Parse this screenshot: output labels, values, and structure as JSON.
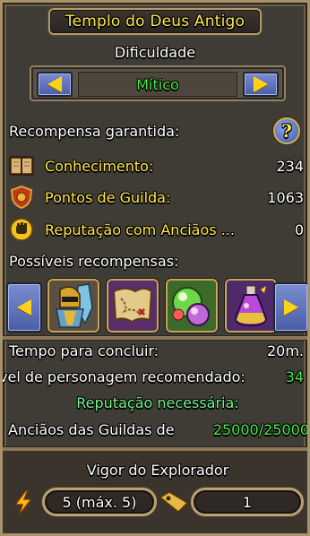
{
  "title": "Templo do Deus Antigo",
  "difficulty": {
    "label": "Dificuldade",
    "value": "Mítico"
  },
  "guaranteed": {
    "heading": "Recompensa garantida:",
    "items": [
      {
        "icon": "book-icon",
        "label": "Conhecimento:",
        "value": "234"
      },
      {
        "icon": "guild-shield-icon",
        "label": "Pontos de Guilda:",
        "value": "1063"
      },
      {
        "icon": "elders-fist-icon",
        "label": "Reputação com Anciãos ...",
        "value": "0"
      }
    ]
  },
  "possible": {
    "heading": "Possíveis recompensas:",
    "items": [
      {
        "icon": "knight-armor-icon"
      },
      {
        "icon": "treasure-map-icon"
      },
      {
        "icon": "magic-orbs-icon"
      },
      {
        "icon": "potion-flask-icon"
      }
    ]
  },
  "info": {
    "time_label": "Tempo para concluir:",
    "time_value": "20m.",
    "level_label": "vel de personagem recomendado:",
    "level_value": "34",
    "rep_required": "Reputação necessária:",
    "rep_label": "Anciãos das Guildas de",
    "rep_value": "25000/25000"
  },
  "vigor": {
    "title": "Vigor do Explorador",
    "energy": "5 (máx. 5)",
    "tickets": "1"
  },
  "colors": {
    "label_gold": "#ffe94a",
    "value_green": "#48e845",
    "button_blue": "#4a5ea8",
    "frame_gold": "#c8a75a"
  }
}
